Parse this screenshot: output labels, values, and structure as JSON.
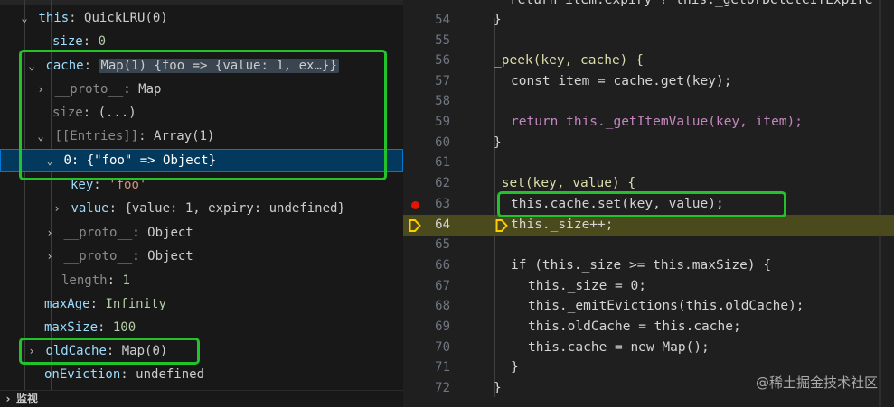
{
  "variables": {
    "rows": [
      {
        "twisty": "open",
        "name": "this",
        "value": "QuickLRU(0)"
      },
      {
        "twisty": "",
        "name": "size",
        "value": "0",
        "value_kind": "num"
      },
      {
        "twisty": "open",
        "name": "cache",
        "value": "Map(1) {foo => {value: 1, ex…}}",
        "highlight": true
      },
      {
        "twisty": "closed",
        "name": "__proto__",
        "value": "Map",
        "dim": true
      },
      {
        "twisty": "",
        "name": "size",
        "value": "(...)",
        "dim": true
      },
      {
        "twisty": "open",
        "name": "[[Entries]]",
        "value": "Array(1)",
        "dim": true
      },
      {
        "twisty": "open",
        "name": "0",
        "value": "{\"foo\" => Object}",
        "selected": true
      },
      {
        "twisty": "",
        "name": "key",
        "value": "'foo'",
        "value_kind": "str"
      },
      {
        "twisty": "closed",
        "name": "value",
        "value": "{value: 1, expiry: undefined}"
      },
      {
        "twisty": "closed",
        "name": "__proto__",
        "value": "Object",
        "dim": true
      },
      {
        "twisty": "closed",
        "name": "__proto__",
        "value": "Object",
        "dim": true
      },
      {
        "twisty": "",
        "name": "length",
        "value": "1",
        "value_kind": "num",
        "dim": true
      },
      {
        "twisty": "",
        "name": "maxAge",
        "value": "Infinity",
        "value_kind": "num"
      },
      {
        "twisty": "",
        "name": "maxSize",
        "value": "100",
        "value_kind": "num"
      },
      {
        "twisty": "closed",
        "name": "oldCache",
        "value": "Map(0)"
      },
      {
        "twisty": "",
        "name": "onEviction",
        "value": "undefined"
      }
    ],
    "watch_header": "监视"
  },
  "editor": {
    "lines": [
      {
        "num": "54",
        "text": "}"
      },
      {
        "num": "55",
        "text": ""
      },
      {
        "num": "56",
        "text": "_peek(key, cache) {"
      },
      {
        "num": "57",
        "text": "const item = cache.get(key);"
      },
      {
        "num": "58",
        "text": ""
      },
      {
        "num": "59",
        "text": "return this._getItemValue(key, item);"
      },
      {
        "num": "60",
        "text": "}"
      },
      {
        "num": "61",
        "text": ""
      },
      {
        "num": "62",
        "text": "_set(key, value) {"
      },
      {
        "num": "63",
        "text": "this.cache.set(key, value);",
        "breakpoint": true
      },
      {
        "num": "64",
        "text": "this._size++;",
        "current": true
      },
      {
        "num": "65",
        "text": ""
      },
      {
        "num": "66",
        "text": "if (this._size >= this.maxSize) {"
      },
      {
        "num": "67",
        "text": "this._size = 0;"
      },
      {
        "num": "68",
        "text": "this._emitEvictions(this.oldCache);"
      },
      {
        "num": "69",
        "text": "this.oldCache = this.cache;"
      },
      {
        "num": "70",
        "text": "this.cache = new Map();"
      },
      {
        "num": "71",
        "text": "}"
      },
      {
        "num": "72",
        "text": "}"
      }
    ],
    "partial_top_line": "return item.expiry ? this._getOrDeleteIfExpire"
  },
  "watermark": "@稀土掘金技术社区",
  "colors": {
    "annotation_box": "#22c22a",
    "selection": "#04395e",
    "current_line": "#4b4a1c",
    "breakpoint": "#e51400"
  }
}
